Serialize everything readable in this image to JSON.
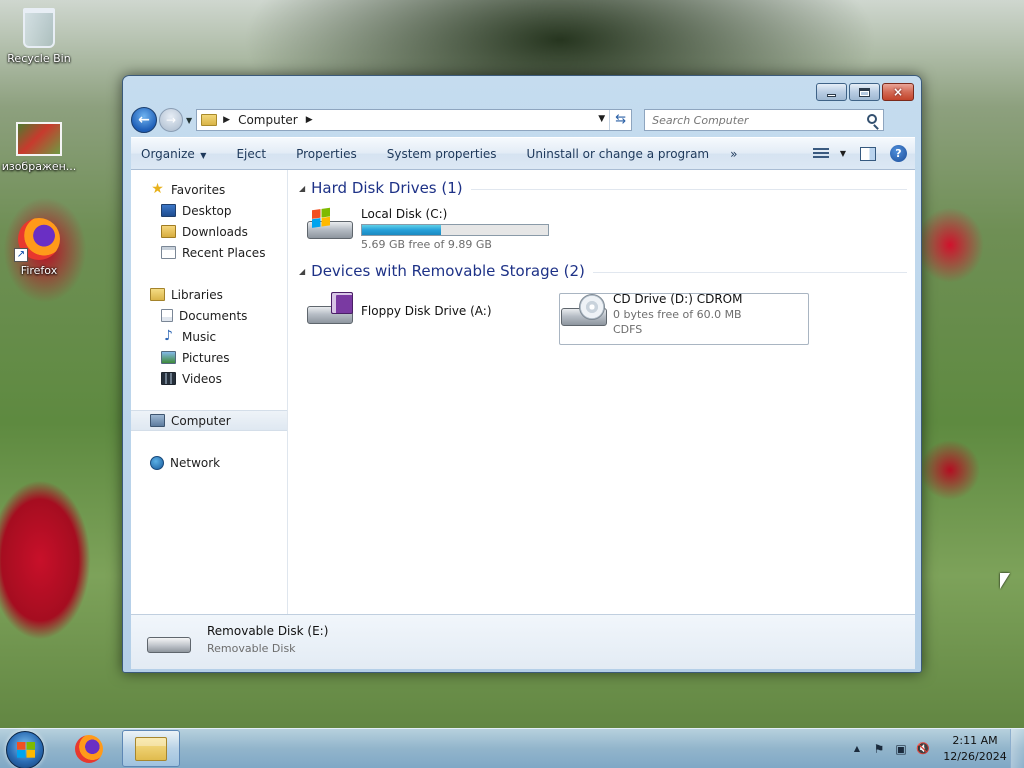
{
  "desktop": {
    "icons": [
      {
        "label": "Recycle Bin",
        "icon": "recycle-bin-icon"
      },
      {
        "label": "изображен...",
        "icon": "image-file-icon"
      },
      {
        "label": "Firefox",
        "icon": "firefox-icon"
      }
    ]
  },
  "window": {
    "buttons": {
      "minimize": "minimize-icon",
      "maximize": "maximize-icon",
      "close": "×"
    },
    "address": {
      "segment": "Computer"
    },
    "search": {
      "placeholder": "Search Computer"
    },
    "toolbar": {
      "organize": "Organize",
      "eject": "Eject",
      "properties": "Properties",
      "system_properties": "System properties",
      "uninstall": "Uninstall or change a program",
      "more": "»"
    },
    "navpane": {
      "favorites": "Favorites",
      "desktop": "Desktop",
      "downloads": "Downloads",
      "recent_places": "Recent Places",
      "libraries": "Libraries",
      "documents": "Documents",
      "music": "Music",
      "pictures": "Pictures",
      "videos": "Videos",
      "computer": "Computer",
      "network": "Network"
    },
    "sections": {
      "hdd_title": "Hard Disk Drives (1)",
      "removable_title": "Devices with Removable Storage (2)"
    },
    "drives": {
      "local_disk": {
        "name": "Local Disk (C:)",
        "free_text": "5.69 GB free of 9.89 GB",
        "used_fraction": 0.425
      },
      "floppy": {
        "name": "Floppy Disk Drive (A:)"
      },
      "cd": {
        "name": "CD Drive (D:) CDROM",
        "free_text": "0 bytes free of 60.0 MB",
        "fs": "CDFS"
      }
    },
    "details": {
      "name": "Removable Disk (E:)",
      "type": "Removable Disk"
    }
  },
  "taskbar": {
    "time": "2:11 AM",
    "date": "12/26/2024",
    "tray": {
      "up": "▲",
      "flag": "⚑",
      "sound": "🔇"
    }
  }
}
